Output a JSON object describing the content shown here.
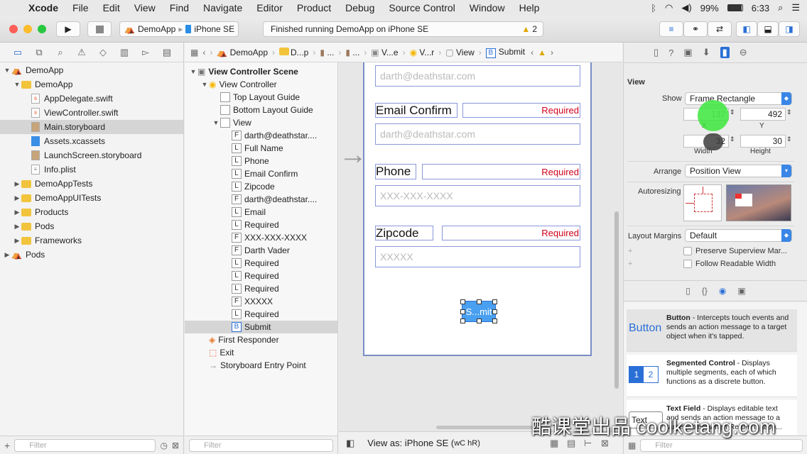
{
  "menubar": {
    "app": "Xcode",
    "items": [
      "File",
      "Edit",
      "View",
      "Find",
      "Navigate",
      "Editor",
      "Product",
      "Debug",
      "Source Control",
      "Window",
      "Help"
    ],
    "battery": "99%",
    "time": "6:33"
  },
  "toolbar": {
    "scheme": "DemoApp",
    "device": "iPhone SE",
    "status": "Finished running DemoApp on iPhone SE",
    "warning_count": "2"
  },
  "navigator": {
    "items": [
      {
        "label": "DemoApp",
        "indent": 0,
        "type": "project",
        "open": true
      },
      {
        "label": "DemoApp",
        "indent": 1,
        "type": "folder",
        "open": true
      },
      {
        "label": "AppDelegate.swift",
        "indent": 2,
        "type": "swift"
      },
      {
        "label": "ViewController.swift",
        "indent": 2,
        "type": "swift"
      },
      {
        "label": "Main.storyboard",
        "indent": 2,
        "type": "storyboard",
        "selected": true
      },
      {
        "label": "Assets.xcassets",
        "indent": 2,
        "type": "assets"
      },
      {
        "label": "LaunchScreen.storyboard",
        "indent": 2,
        "type": "storyboard"
      },
      {
        "label": "Info.plist",
        "indent": 2,
        "type": "plist"
      },
      {
        "label": "DemoAppTests",
        "indent": 1,
        "type": "folder",
        "closed": true
      },
      {
        "label": "DemoAppUITests",
        "indent": 1,
        "type": "folder",
        "closed": true
      },
      {
        "label": "Products",
        "indent": 1,
        "type": "folder",
        "closed": true
      },
      {
        "label": "Pods",
        "indent": 1,
        "type": "folder",
        "closed": true
      },
      {
        "label": "Frameworks",
        "indent": 1,
        "type": "folder",
        "closed": true
      },
      {
        "label": "Pods",
        "indent": 0,
        "type": "project",
        "closed": true
      }
    ],
    "filter_placeholder": "Filter"
  },
  "jumpbar": [
    "DemoApp",
    "D...p",
    "...",
    "...",
    "V...e",
    "V...r",
    "View",
    "Submit"
  ],
  "outline": {
    "items": [
      {
        "label": "View Controller Scene",
        "indent": 0,
        "icon": "scene",
        "bold": true,
        "open": true
      },
      {
        "label": "View Controller",
        "indent": 1,
        "icon": "vc",
        "open": true
      },
      {
        "label": "Top Layout Guide",
        "indent": 2,
        "icon": "guide"
      },
      {
        "label": "Bottom Layout Guide",
        "indent": 2,
        "icon": "guide"
      },
      {
        "label": "View",
        "indent": 2,
        "icon": "view",
        "open": true
      },
      {
        "label": "darth@deathstar....",
        "indent": 3,
        "icon": "F"
      },
      {
        "label": "Full Name",
        "indent": 3,
        "icon": "L"
      },
      {
        "label": "Phone",
        "indent": 3,
        "icon": "L"
      },
      {
        "label": "Email Confirm",
        "indent": 3,
        "icon": "L"
      },
      {
        "label": "Zipcode",
        "indent": 3,
        "icon": "L"
      },
      {
        "label": "darth@deathstar....",
        "indent": 3,
        "icon": "F"
      },
      {
        "label": "Email",
        "indent": 3,
        "icon": "L"
      },
      {
        "label": "Required",
        "indent": 3,
        "icon": "L"
      },
      {
        "label": "XXX-XXX-XXXX",
        "indent": 3,
        "icon": "F"
      },
      {
        "label": "Darth Vader",
        "indent": 3,
        "icon": "F"
      },
      {
        "label": "Required",
        "indent": 3,
        "icon": "L"
      },
      {
        "label": "Required",
        "indent": 3,
        "icon": "L"
      },
      {
        "label": "Required",
        "indent": 3,
        "icon": "L"
      },
      {
        "label": "XXXXX",
        "indent": 3,
        "icon": "F"
      },
      {
        "label": "Required",
        "indent": 3,
        "icon": "L"
      },
      {
        "label": "Submit",
        "indent": 3,
        "icon": "B",
        "selected": true
      },
      {
        "label": "First Responder",
        "indent": 1,
        "icon": "responder"
      },
      {
        "label": "Exit",
        "indent": 1,
        "icon": "exit"
      },
      {
        "label": "Storyboard Entry Point",
        "indent": 1,
        "icon": "entry"
      }
    ],
    "filter_placeholder": "Filter"
  },
  "canvas": {
    "email_placeholder": "darth@deathstar.com",
    "email_confirm_label": "Email Confirm",
    "required": "Required",
    "email_confirm_placeholder": "darth@deathstar.com",
    "phone_label": "Phone",
    "phone_placeholder": "XXX-XXX-XXXX",
    "zipcode_label": "Zipcode",
    "zipcode_placeholder": "XXXXX",
    "submit_label": "S...mit",
    "view_as": "View as: iPhone SE (",
    "view_as_size": "wC hR)"
  },
  "inspector": {
    "section": "View",
    "show_label": "Show",
    "show_value": "Frame Rectangle",
    "x": "137",
    "y": "492",
    "x_label": "X",
    "y_label": "Y",
    "width": "32",
    "height": "30",
    "width_label": "Width",
    "height_label": "Height",
    "arrange_label": "Arrange",
    "arrange_value": "Position View",
    "autoresizing_label": "Autoresizing",
    "layout_margins_label": "Layout Margins",
    "layout_margins_value": "Default",
    "preserve_label": "Preserve Superview Mar...",
    "follow_label": "Follow Readable Width",
    "library": [
      {
        "title": "Button",
        "desc": " - Intercepts touch events and sends an action message to a target object when it's tapped.",
        "icon": "Button"
      },
      {
        "title": "Segmented Control",
        "desc": " - Displays multiple segments, each of which functions as a discrete button.",
        "icon": "12"
      },
      {
        "title": "Text Field",
        "desc": " - Displays editable text and sends an action message to a target object when Return is tapp...",
        "icon": "Text"
      }
    ],
    "filter_placeholder": "Filter"
  },
  "watermark": "酷课堂出品 coolketang.com"
}
